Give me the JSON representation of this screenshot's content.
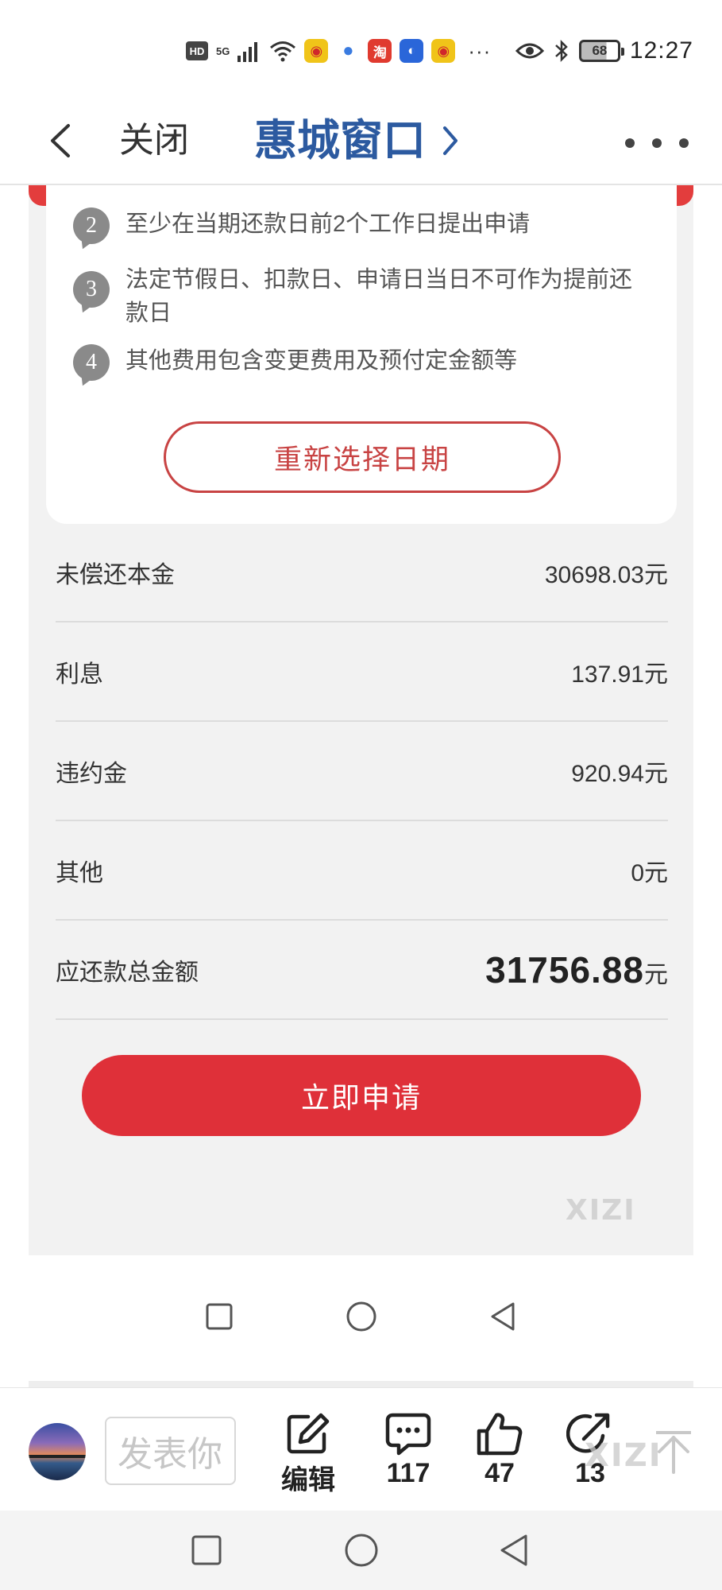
{
  "status_bar": {
    "hd": "HD",
    "net": "5G",
    "app_icons": [
      "weibo-icon",
      "browser-icon",
      "taobao-icon",
      "bulb-app-icon",
      "weibo-icon"
    ],
    "more": "···",
    "battery": "68",
    "time": "12:27"
  },
  "nav": {
    "close_label": "关闭",
    "title": "惠城窗口"
  },
  "notes": [
    {
      "num": "2",
      "text": "至少在当期还款日前2个工作日提出申请"
    },
    {
      "num": "3",
      "text": "法定节假日、扣款日、申请日当日不可作为提前还款日"
    },
    {
      "num": "4",
      "text": "其他费用包含变更费用及预付定金额等"
    }
  ],
  "reselect_label": "重新选择日期",
  "rows": [
    {
      "label": "未偿还本金",
      "value": "30698.03",
      "unit": "元"
    },
    {
      "label": "利息",
      "value": "137.91",
      "unit": "元"
    },
    {
      "label": "违约金",
      "value": "920.94",
      "unit": "元"
    },
    {
      "label": "其他",
      "value": "0",
      "unit": "元"
    }
  ],
  "total": {
    "label": "应还款总金额",
    "value": "31756.88",
    "unit": "元"
  },
  "apply_label": "立即申请",
  "watermark": "XIZI",
  "comment_bar": {
    "placeholder": "发表你",
    "edit_label": "编辑",
    "comments_count": "117",
    "likes_count": "47",
    "shares_count": "13"
  },
  "colors": {
    "title_blue": "#2c5aa0",
    "accent_red": "#df3039",
    "outline_red": "#c84343"
  }
}
